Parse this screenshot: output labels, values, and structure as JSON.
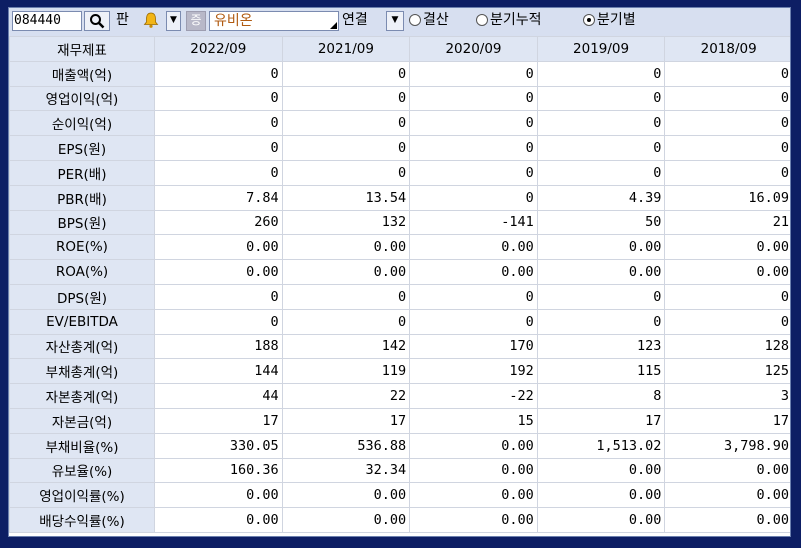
{
  "toolbar": {
    "code_value": "084440",
    "pan_label": "판",
    "dropdown_arrow": "▼",
    "badge_text": "증",
    "stock_name": "유비온",
    "link_label": "연결",
    "radios": [
      {
        "label": "결산",
        "selected": false
      },
      {
        "label": "분기누적",
        "selected": false
      },
      {
        "label": "분기별",
        "selected": true
      }
    ],
    "icons": [
      "search-icon",
      "bell-icon"
    ]
  },
  "table": {
    "header": [
      "재무제표",
      "2022/09",
      "2021/09",
      "2020/09",
      "2019/09",
      "2018/09"
    ],
    "rows": [
      {
        "label": "매출액(억)",
        "values": [
          "0",
          "0",
          "0",
          "0",
          "0"
        ]
      },
      {
        "label": "영업이익(억)",
        "values": [
          "0",
          "0",
          "0",
          "0",
          "0"
        ]
      },
      {
        "label": "순이익(억)",
        "values": [
          "0",
          "0",
          "0",
          "0",
          "0"
        ]
      },
      {
        "label": "EPS(원)",
        "values": [
          "0",
          "0",
          "0",
          "0",
          "0"
        ]
      },
      {
        "label": "PER(배)",
        "values": [
          "0",
          "0",
          "0",
          "0",
          "0"
        ]
      },
      {
        "label": "PBR(배)",
        "values": [
          "7.84",
          "13.54",
          "0",
          "4.39",
          "16.09"
        ]
      },
      {
        "label": "BPS(원)",
        "values": [
          "260",
          "132",
          "-141",
          "50",
          "21"
        ]
      },
      {
        "label": "ROE(%)",
        "values": [
          "0.00",
          "0.00",
          "0.00",
          "0.00",
          "0.00"
        ]
      },
      {
        "label": "ROA(%)",
        "values": [
          "0.00",
          "0.00",
          "0.00",
          "0.00",
          "0.00"
        ]
      },
      {
        "label": "DPS(원)",
        "values": [
          "0",
          "0",
          "0",
          "0",
          "0"
        ]
      },
      {
        "label": "EV/EBITDA",
        "values": [
          "0",
          "0",
          "0",
          "0",
          "0"
        ]
      },
      {
        "label": "자산총계(억)",
        "values": [
          "188",
          "142",
          "170",
          "123",
          "128"
        ]
      },
      {
        "label": "부채총계(억)",
        "values": [
          "144",
          "119",
          "192",
          "115",
          "125"
        ]
      },
      {
        "label": "자본총계(억)",
        "values": [
          "44",
          "22",
          "-22",
          "8",
          "3"
        ]
      },
      {
        "label": "자본금(억)",
        "values": [
          "17",
          "17",
          "15",
          "17",
          "17"
        ]
      },
      {
        "label": "부채비율(%)",
        "values": [
          "330.05",
          "536.88",
          "0.00",
          "1,513.02",
          "3,798.90"
        ]
      },
      {
        "label": "유보율(%)",
        "values": [
          "160.36",
          "32.34",
          "0.00",
          "0.00",
          "0.00"
        ]
      },
      {
        "label": "영업이익률(%)",
        "values": [
          "0.00",
          "0.00",
          "0.00",
          "0.00",
          "0.00"
        ]
      },
      {
        "label": "배당수익률(%)",
        "values": [
          "0.00",
          "0.00",
          "0.00",
          "0.00",
          "0.00"
        ]
      }
    ]
  }
}
